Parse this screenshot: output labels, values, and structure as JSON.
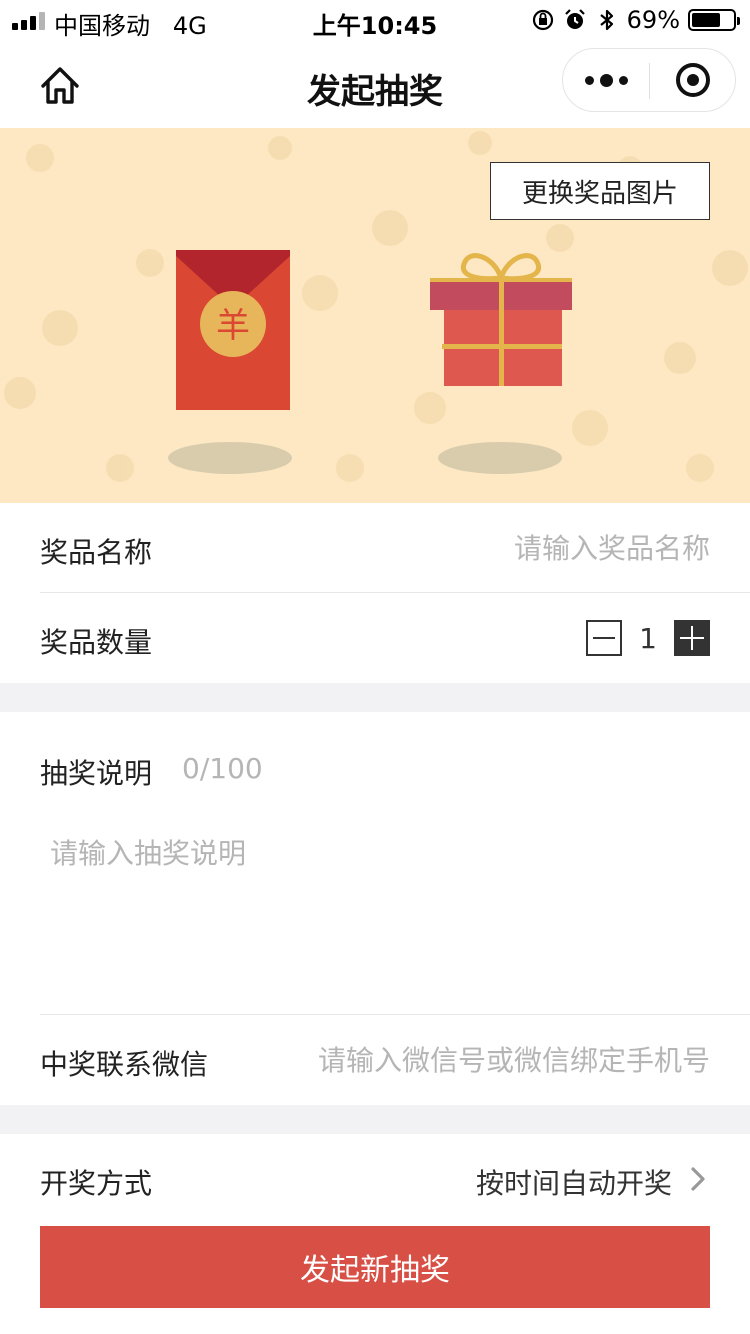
{
  "status_bar": {
    "carrier": "中国移动",
    "network": "4G",
    "time": "上午10:45",
    "battery_percent": "69%",
    "battery_level": 0.69
  },
  "nav": {
    "title": "发起抽奖",
    "icons": [
      "home-icon",
      "more-icon",
      "close-miniprogram-icon"
    ]
  },
  "banner": {
    "change_image_label": "更换奖品图片",
    "background_color": "#fde8c3",
    "red_envelope_symbol": "羊"
  },
  "form": {
    "prize_name": {
      "label": "奖品名称",
      "placeholder": "请输入奖品名称"
    },
    "prize_quantity": {
      "label": "奖品数量",
      "value": "1"
    },
    "description": {
      "label": "抽奖说明",
      "counter": "0/100",
      "placeholder": "请输入抽奖说明"
    },
    "contact_wechat": {
      "label": "中奖联系微信",
      "placeholder": "请输入微信号或微信绑定手机号"
    },
    "draw_method": {
      "label": "开奖方式",
      "value": "按时间自动开奖"
    }
  },
  "submit": {
    "label": "发起新抽奖",
    "color": "#d84f45"
  }
}
